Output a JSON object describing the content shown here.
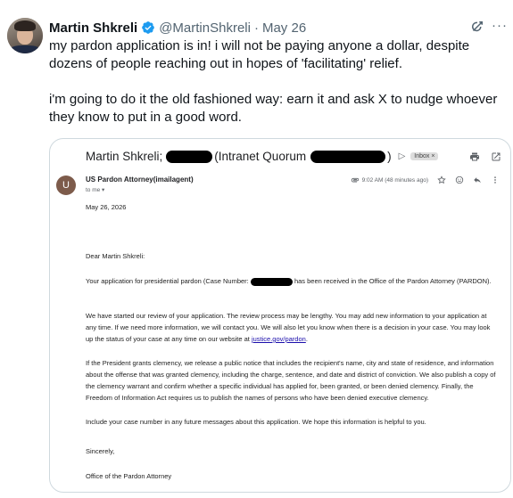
{
  "tweet": {
    "author_name": "Martin Shkreli",
    "handle": "@MartinShkreli",
    "separator": "·",
    "date": "May 26",
    "more_label": "···",
    "text_1": "my pardon application is in! i will not be paying anyone a dollar, despite dozens of people reaching out in hopes of 'facilitating' relief.",
    "text_2": "i'm going to do it the old fashioned way: earn it and ask X to nudge whoever they know to put in a good word."
  },
  "email": {
    "subject_prefix": "Martin Shkreli;",
    "subject_middle": "(Intranet Quorum",
    "subject_suffix": ")",
    "inbox_label": "Inbox ×",
    "sender_initial": "U",
    "sender_name": "US Pardon Attorney(imailagent)",
    "to_me": "to me ▾",
    "time": "9:02 AM (48 minutes ago)",
    "date_line": "May 26, 2026",
    "greeting": "Dear Martin Shkreli:",
    "para1_a": "Your application for presidential pardon (Case Number:",
    "para1_b": " has been received in the Office of the Pardon Attorney (PARDON).",
    "para2_a": "We have started our review of your application. The review process may be lengthy. You may add new information to your application at any time. If we need more information, we will contact you. We will also let you know when there is a decision in your case. You may look up the status of your case at any time on our website at ",
    "para2_link": "justice.gov/pardon",
    "para2_b": ".",
    "para3": "If the President grants clemency, we release a public notice that includes the recipient's name, city and state of residence, and information about the offense that was granted clemency, including the charge, sentence, and date and district of conviction. We also publish a copy of the clemency warrant and confirm whether a specific individual has applied for, been granted, or been denied clemency. Finally, the Freedom of Information Act requires us to publish the names of persons who have been denied executive clemency.",
    "para4": "Include your case number in any future messages about this application. We hope this information is helpful to you.",
    "sincerely": "Sincerely,",
    "signature": "Office of the Pardon Attorney"
  },
  "colors": {
    "verified_blue": "#1d9bf0",
    "secondary_text": "#536471",
    "link": "#1a0dab",
    "sender_avatar": "#7d5b4b"
  }
}
